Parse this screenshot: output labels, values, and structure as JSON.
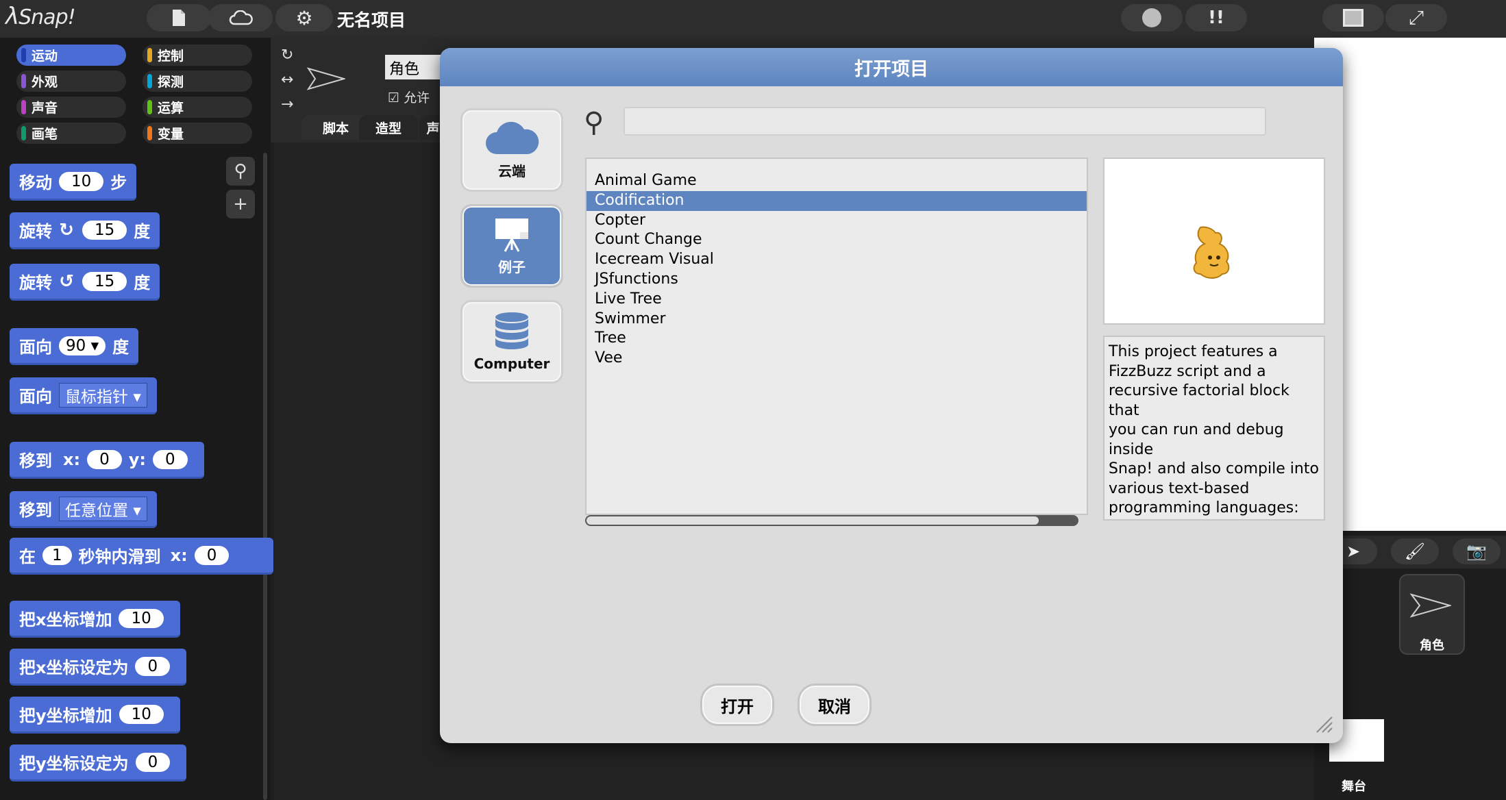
{
  "topbar": {
    "logo": "Snap!",
    "project_title": "无名项目"
  },
  "categories": [
    {
      "label": "运动",
      "color": "#4a6cd4",
      "active": true
    },
    {
      "label": "控制",
      "color": "#e6a822"
    },
    {
      "label": "外观",
      "color": "#8a55d7"
    },
    {
      "label": "探测",
      "color": "#04a6d5"
    },
    {
      "label": "声音",
      "color": "#bb42c3"
    },
    {
      "label": "运算",
      "color": "#62c213"
    },
    {
      "label": "画笔",
      "color": "#0e9a6c"
    },
    {
      "label": "变量",
      "color": "#f3761d"
    }
  ],
  "palette": {
    "move": {
      "label": "移动",
      "value": "10",
      "unit": "步"
    },
    "turn_cw": {
      "label": "旋转",
      "value": "15",
      "unit": "度"
    },
    "turn_ccw": {
      "label": "旋转",
      "value": "15",
      "unit": "度"
    },
    "point_dir": {
      "label": "面向",
      "value": "90",
      "unit": "度"
    },
    "point_toward": {
      "label": "面向",
      "value": "鼠标指针"
    },
    "goto_xy": {
      "label": "移到",
      "x_label": "x:",
      "x": "0",
      "y_label": "y:",
      "y": "0"
    },
    "goto": {
      "label": "移到",
      "value": "任意位置"
    },
    "glide": {
      "label": "在",
      "secs": "1",
      "mid": "秒钟内滑到",
      "x_label": "x:",
      "x": "0"
    },
    "change_x": {
      "label": "把x坐标增加",
      "value": "10"
    },
    "set_x": {
      "label": "把x坐标设定为",
      "value": "0"
    },
    "change_y": {
      "label": "把y坐标增加",
      "value": "10"
    },
    "set_y": {
      "label": "把y坐标设定为",
      "value": "0"
    }
  },
  "sprite_bar": {
    "sprite_name": "角色",
    "draggable_label": "允许",
    "tabs": [
      "脚本",
      "造型",
      "声"
    ]
  },
  "corral": {
    "sprite_label": "角色",
    "stage_label": "舞台"
  },
  "dialog": {
    "title": "打开项目",
    "sources": [
      {
        "label": "云端",
        "icon": "cloud-icon"
      },
      {
        "label": "例子",
        "icon": "examples-icon",
        "active": true
      },
      {
        "label": "Computer",
        "icon": "database-icon"
      }
    ],
    "search_placeholder": "",
    "projects": [
      "Animal Game",
      "Codification",
      "Copter",
      "Count Change",
      "Icecream Visual",
      "JSfunctions",
      "Live Tree",
      "Swimmer",
      "Tree",
      "Vee"
    ],
    "selected_project": "Codification",
    "notes": "This project features a\nFizzBuzz script and a\nrecursive factorial block that\nyou can run and debug inside\nSnap! and also compile into\nvarious text-based\nprogramming languages:\n\n   * JavaScript\n   * Smalltalk\n   * Python\n   * C\n\nEnjoy!\n-Jens",
    "open_label": "打开",
    "cancel_label": "取消"
  }
}
